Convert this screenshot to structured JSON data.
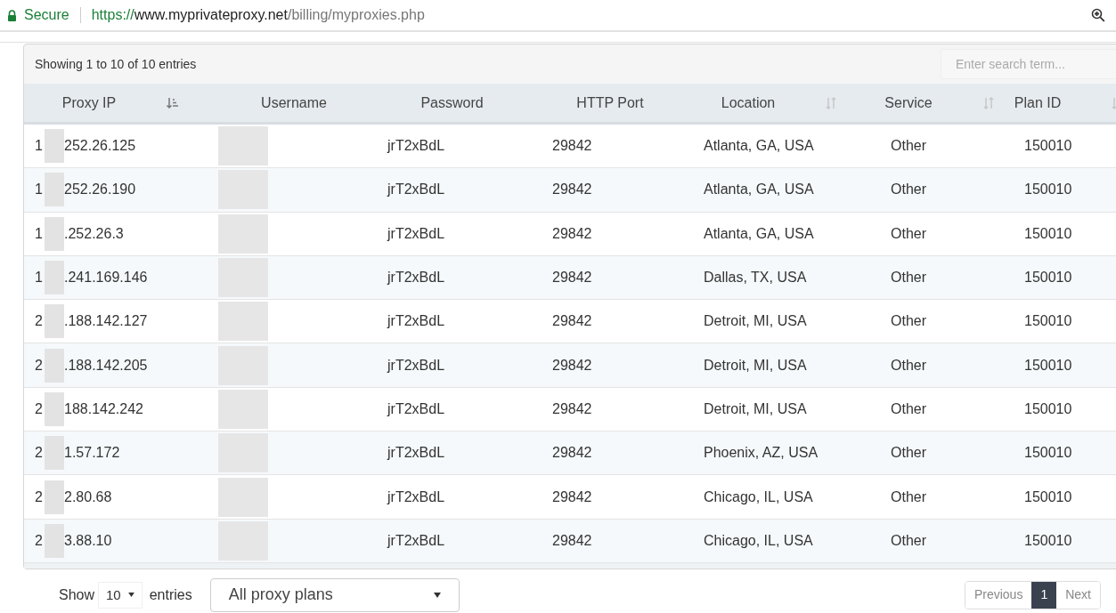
{
  "browser": {
    "secure_label": "Secure",
    "url_scheme": "https://",
    "url_host": "www.myprivateproxy.net",
    "url_path": "/billing/myproxies.php"
  },
  "table_info": "Showing 1 to 10 of 10 entries",
  "search": {
    "placeholder": "Enter search term..."
  },
  "columns": [
    {
      "label": "Proxy IP",
      "sortable": true,
      "sorted": true
    },
    {
      "label": "Username",
      "sortable": false,
      "sorted": false
    },
    {
      "label": "Password",
      "sortable": false,
      "sorted": false
    },
    {
      "label": "HTTP Port",
      "sortable": false,
      "sorted": false
    },
    {
      "label": "Location",
      "sortable": true,
      "sorted": false
    },
    {
      "label": "Service",
      "sortable": true,
      "sorted": false
    },
    {
      "label": "Plan ID",
      "sortable": true,
      "sorted": false
    }
  ],
  "rows": [
    {
      "ip_start": "1",
      "ip_end": "252.26.125",
      "password": "jrT2xBdL",
      "port": "29842",
      "location": "Atlanta, GA, USA",
      "service": "Other",
      "plan_id": "150010"
    },
    {
      "ip_start": "1",
      "ip_end": "252.26.190",
      "password": "jrT2xBdL",
      "port": "29842",
      "location": "Atlanta, GA, USA",
      "service": "Other",
      "plan_id": "150010"
    },
    {
      "ip_start": "1",
      "ip_end": ".252.26.3",
      "password": "jrT2xBdL",
      "port": "29842",
      "location": "Atlanta, GA, USA",
      "service": "Other",
      "plan_id": "150010"
    },
    {
      "ip_start": "1",
      "ip_end": ".241.169.146",
      "password": "jrT2xBdL",
      "port": "29842",
      "location": "Dallas, TX, USA",
      "service": "Other",
      "plan_id": "150010"
    },
    {
      "ip_start": "2",
      "ip_end": ".188.142.127",
      "password": "jrT2xBdL",
      "port": "29842",
      "location": "Detroit, MI, USA",
      "service": "Other",
      "plan_id": "150010"
    },
    {
      "ip_start": "2",
      "ip_end": ".188.142.205",
      "password": "jrT2xBdL",
      "port": "29842",
      "location": "Detroit, MI, USA",
      "service": "Other",
      "plan_id": "150010"
    },
    {
      "ip_start": "2",
      "ip_end": "188.142.242",
      "password": "jrT2xBdL",
      "port": "29842",
      "location": "Detroit, MI, USA",
      "service": "Other",
      "plan_id": "150010"
    },
    {
      "ip_start": "2",
      "ip_end": "1.57.172",
      "password": "jrT2xBdL",
      "port": "29842",
      "location": "Phoenix, AZ, USA",
      "service": "Other",
      "plan_id": "150010"
    },
    {
      "ip_start": "2",
      "ip_end": "2.80.68",
      "password": "jrT2xBdL",
      "port": "29842",
      "location": "Chicago, IL, USA",
      "service": "Other",
      "plan_id": "150010"
    },
    {
      "ip_start": "2",
      "ip_end": "3.88.10",
      "password": "jrT2xBdL",
      "port": "29842",
      "location": "Chicago, IL, USA",
      "service": "Other",
      "plan_id": "150010"
    }
  ],
  "footer": {
    "show_label": "Show",
    "page_size": "10",
    "entries_label": "entries",
    "plan_filter": "All proxy plans"
  },
  "pagination": [
    {
      "label": "Previous",
      "selected": false
    },
    {
      "label": "1",
      "selected": true
    },
    {
      "label": "Next",
      "selected": false
    }
  ]
}
